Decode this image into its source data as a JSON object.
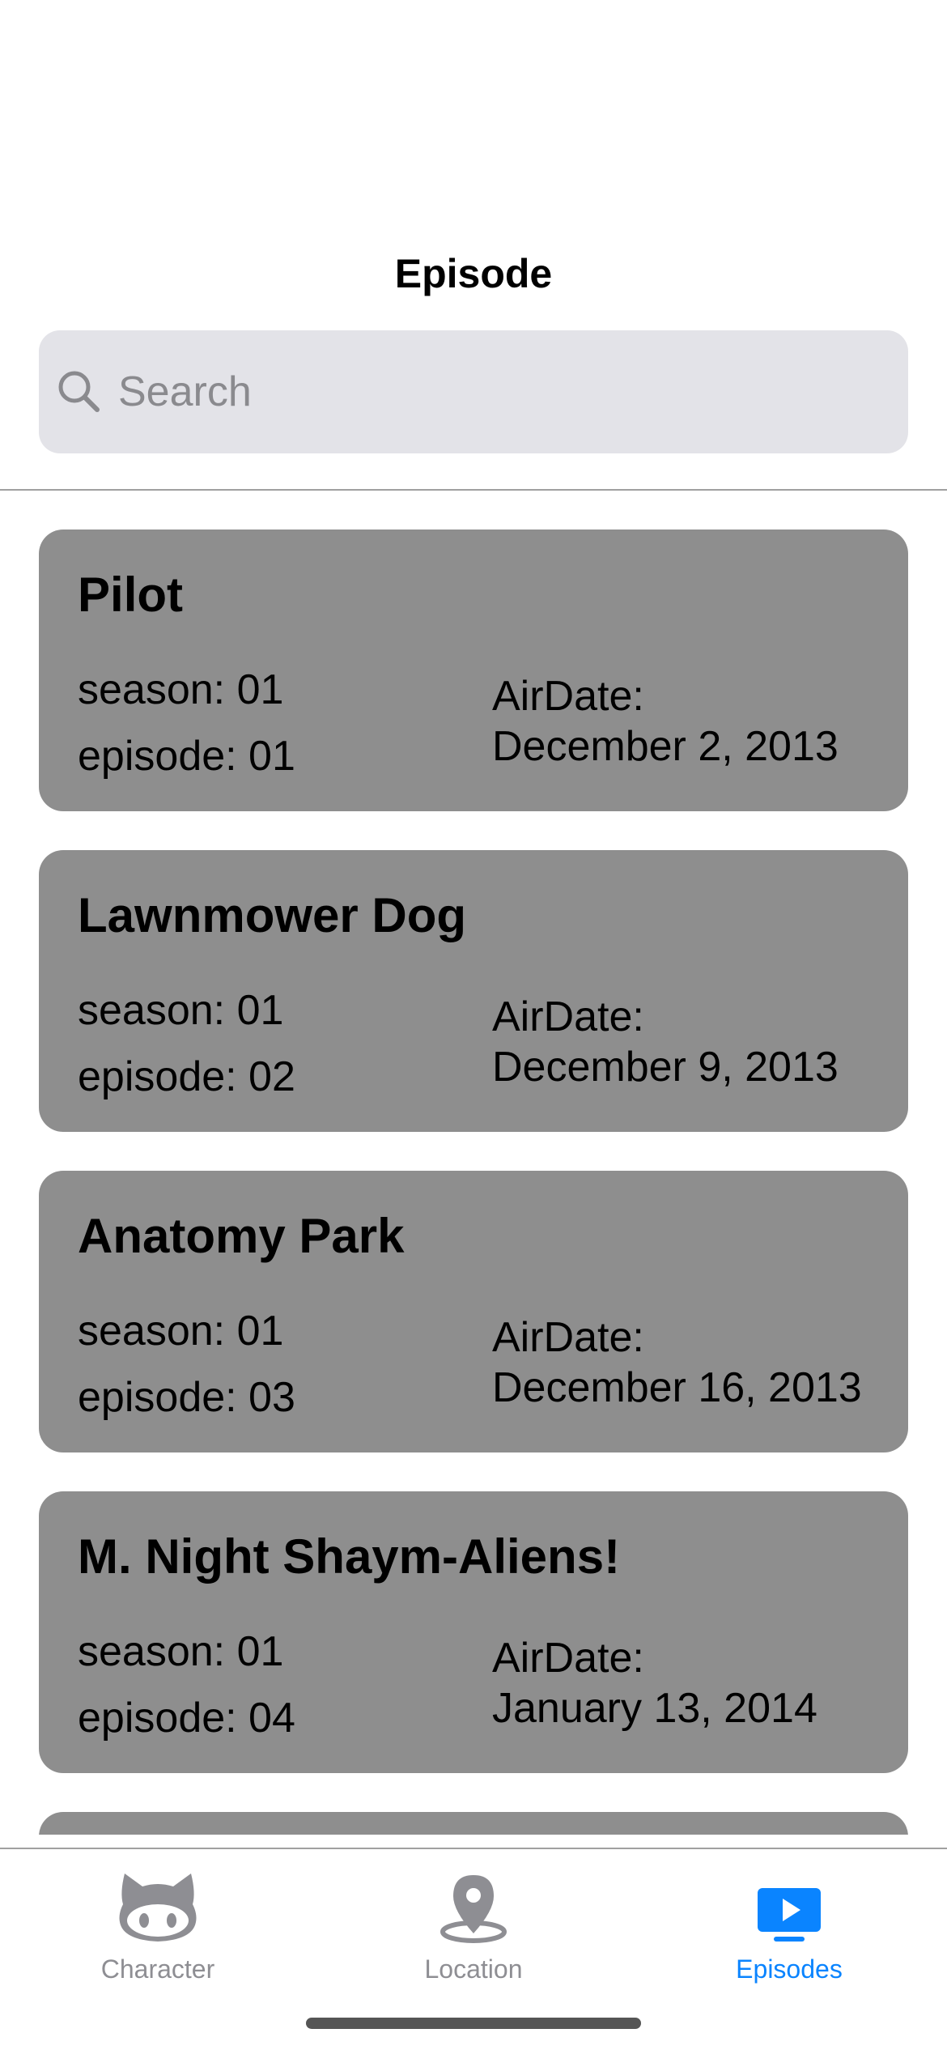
{
  "nav": {
    "title": "Episode"
  },
  "search": {
    "placeholder": "Search",
    "icon": "magnifying-glass"
  },
  "episodes": [
    {
      "name": "Pilot",
      "season": "season: 01",
      "episode": "episode: 01",
      "airdate_label": "AirDate:",
      "airdate": "December 2, 2013"
    },
    {
      "name": "Lawnmower Dog",
      "season": "season: 01",
      "episode": "episode: 02",
      "airdate_label": "AirDate:",
      "airdate": "December 9, 2013"
    },
    {
      "name": "Anatomy Park",
      "season": "season: 01",
      "episode": "episode: 03",
      "airdate_label": "AirDate:",
      "airdate": "December 16, 2013"
    },
    {
      "name": "M. Night Shaym-Aliens!",
      "season": "season: 01",
      "episode": "episode: 04",
      "airdate_label": "AirDate:",
      "airdate": "January 13, 2014"
    }
  ],
  "tabs": [
    {
      "label": "Character",
      "icon": "github-cat-icon",
      "active": false
    },
    {
      "label": "Location",
      "icon": "location-pin-icon",
      "active": false
    },
    {
      "label": "Episodes",
      "icon": "play-tv-icon",
      "active": true
    }
  ],
  "colors": {
    "accent": "#0a84ff",
    "inactive": "#8e8e93",
    "card_background": "#8e8e8e",
    "search_background": "#e3e3e8"
  }
}
